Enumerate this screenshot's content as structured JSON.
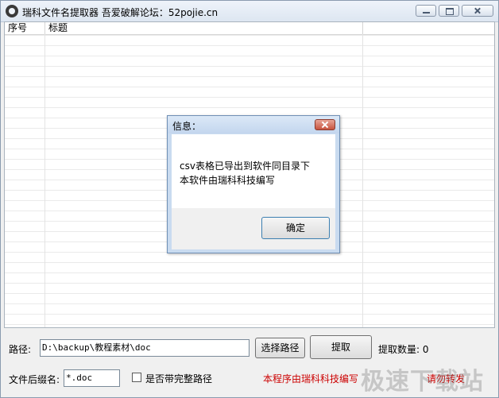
{
  "window": {
    "title": "瑞科文件名提取器    吾爱破解论坛：52pojie.cn"
  },
  "list": {
    "columns": [
      "序号",
      "标题"
    ]
  },
  "form": {
    "path_label": "路径:",
    "path_value": "D:\\backup\\教程素材\\doc",
    "choose_path_button": "选择路径",
    "extract_button": "提取",
    "count_label": "提取数量: 0",
    "ext_label": "文件后缀名:",
    "ext_value": "*.doc",
    "full_path_checkbox_label": "是否带完整路径",
    "full_path_checked": false,
    "credit_text": "本程序由瑞科科技编写 ",
    "credit_text2": "",
    "credit_text3": "请勿转发"
  },
  "dialog": {
    "title": "信息：",
    "line1": "csv表格已导出到软件同目录下",
    "line2": "本软件由瑞科科技编写",
    "ok_button": "确定"
  },
  "watermark": "极速下载站",
  "icons": [
    "app-icon",
    "minimize-icon",
    "maximize-icon",
    "close-icon",
    "dialog-close-icon",
    "checkbox-icon"
  ]
}
